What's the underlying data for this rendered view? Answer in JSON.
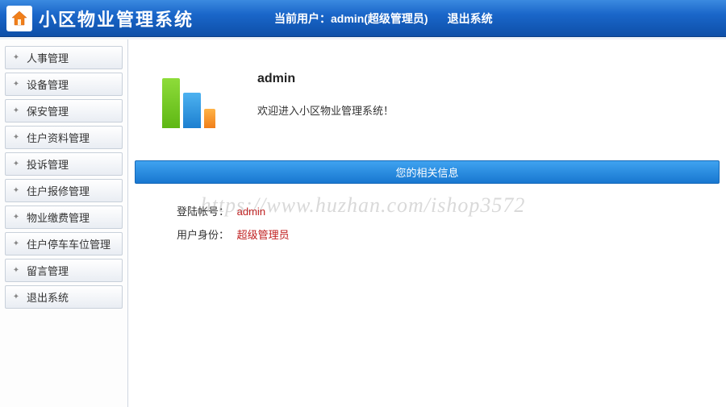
{
  "header": {
    "app_title": "小区物业管理系统",
    "current_user_prefix": "当前用户：",
    "current_user": "admin(超级管理员)",
    "logout_label": "退出系统"
  },
  "sidebar": {
    "items": [
      {
        "label": "人事管理"
      },
      {
        "label": "设备管理"
      },
      {
        "label": "保安管理"
      },
      {
        "label": "住户资料管理"
      },
      {
        "label": "投诉管理"
      },
      {
        "label": "住户报修管理"
      },
      {
        "label": "物业缴费管理"
      },
      {
        "label": "住户停车车位管理"
      },
      {
        "label": "留言管理"
      },
      {
        "label": "退出系统"
      }
    ]
  },
  "welcome": {
    "username": "admin",
    "message": "欢迎进入小区物业管理系统！"
  },
  "info_panel": {
    "title": "您的相关信息",
    "account_label": "登陆帐号：",
    "account_value": "admin",
    "role_label": "用户身份：",
    "role_value": "超级管理员"
  },
  "watermark": "https://www.huzhan.com/ishop3572"
}
